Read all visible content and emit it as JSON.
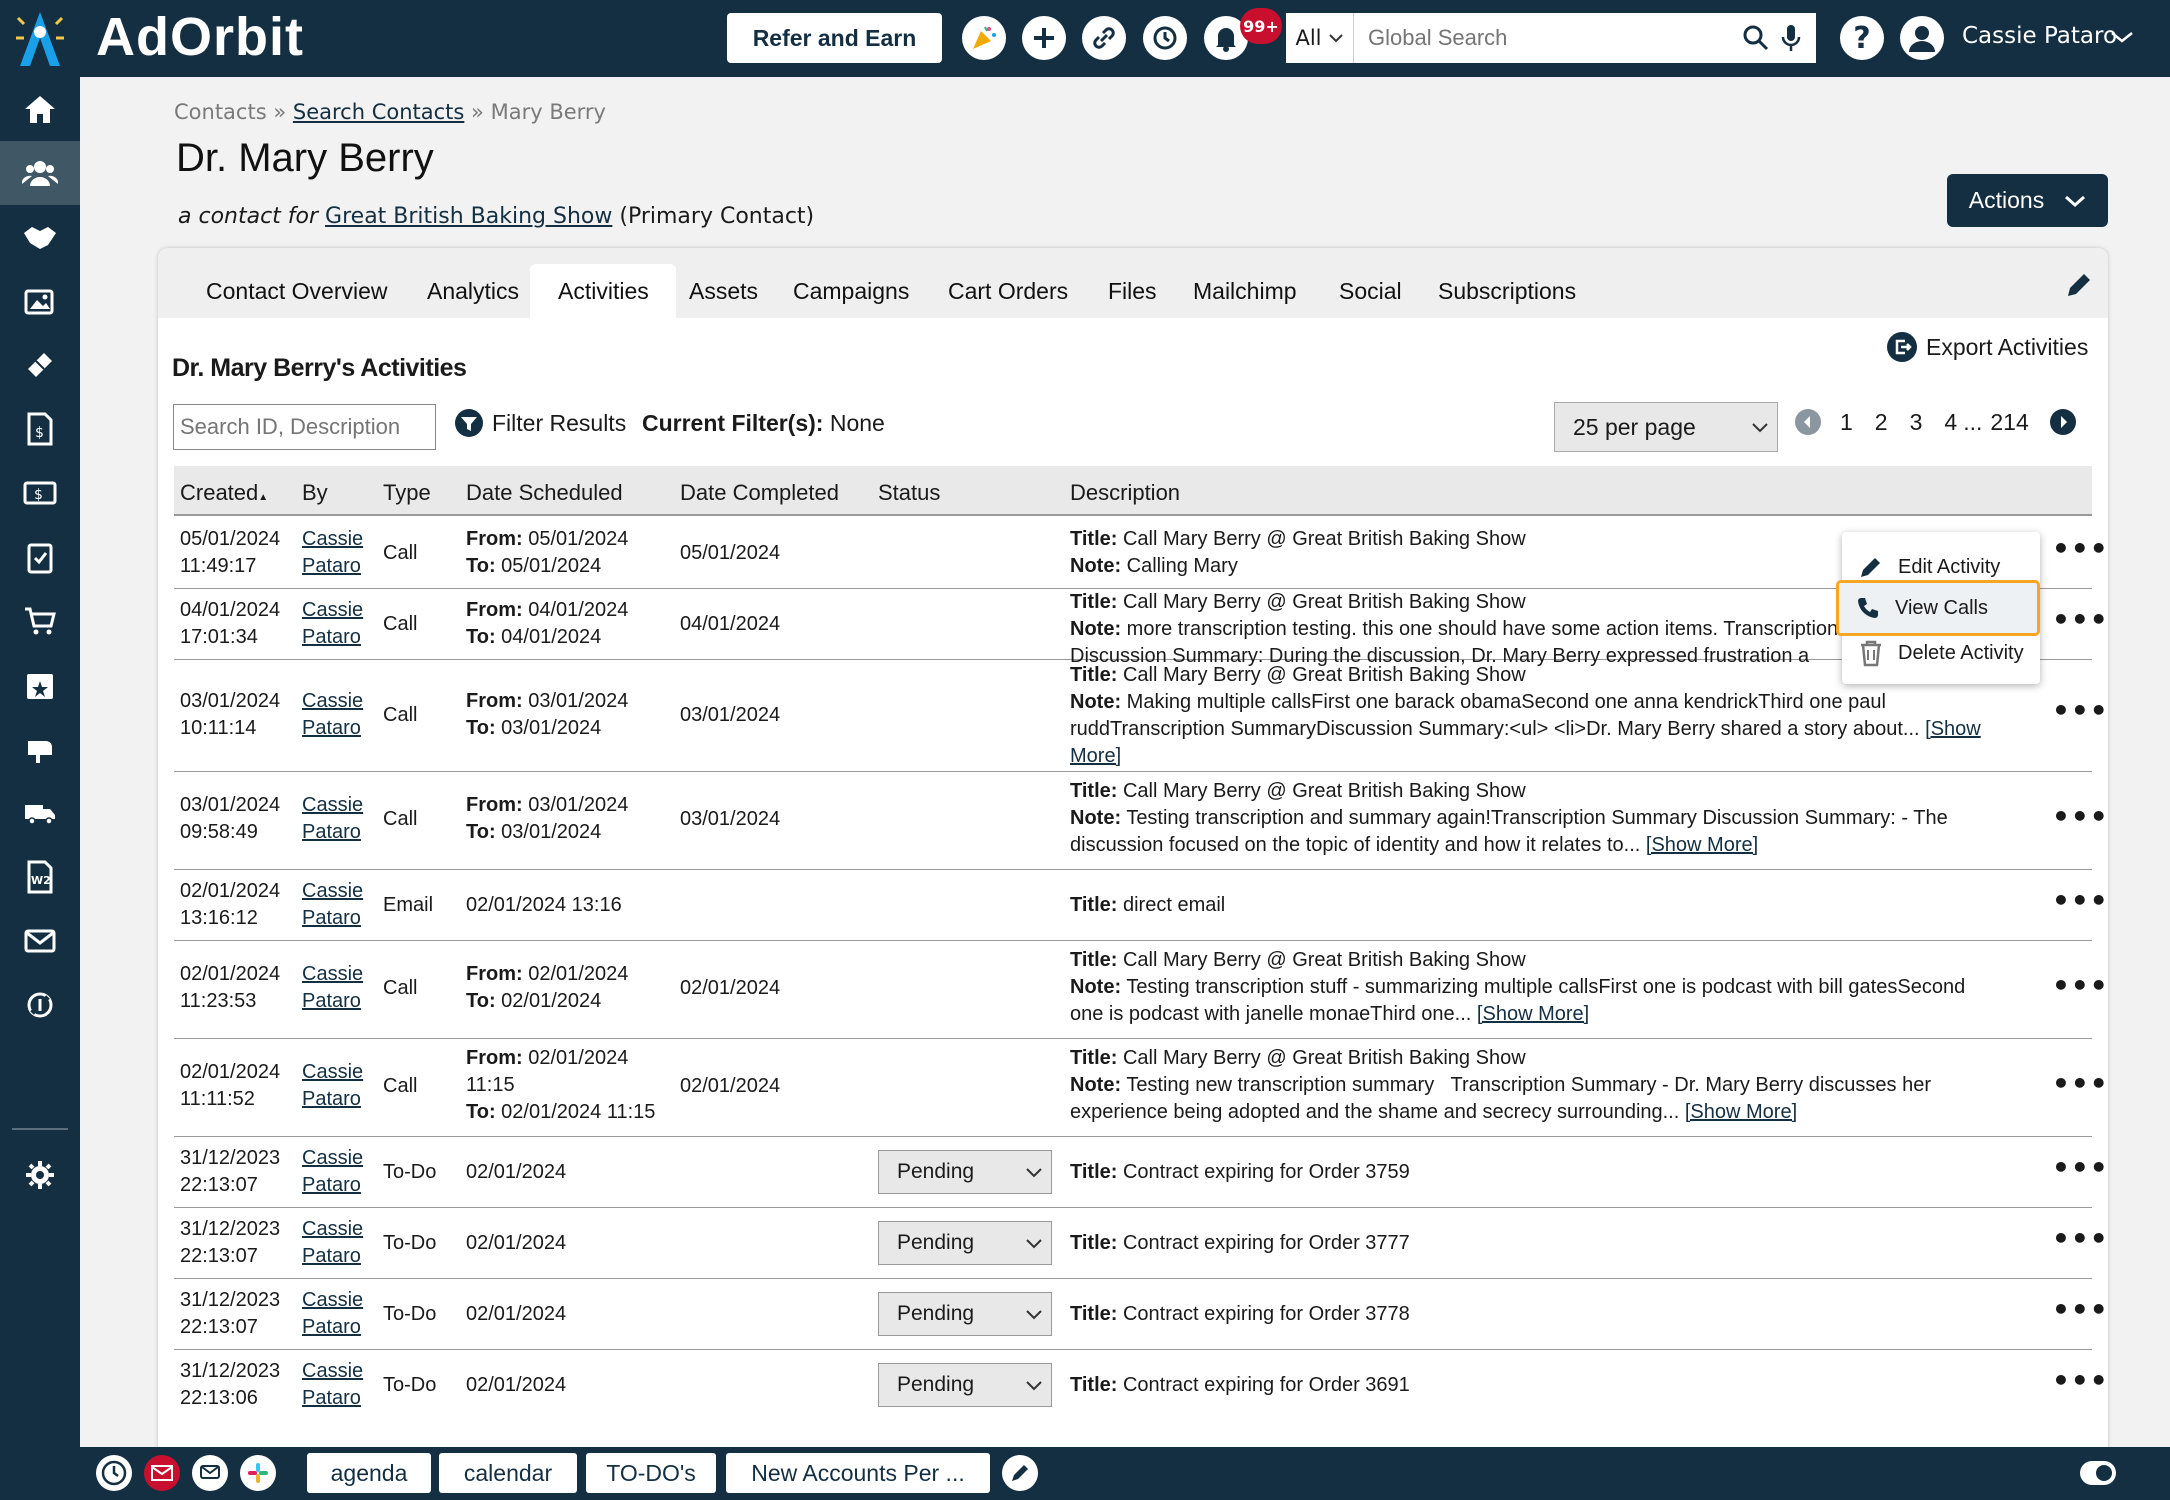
{
  "header": {
    "brand": "AdOrbit",
    "refer_label": "Refer and Earn",
    "notif_badge": "99+",
    "search_scope": "All",
    "search_placeholder": "Global Search",
    "user_name": "Cassie Pataro"
  },
  "breadcrumb": {
    "root": "Contacts",
    "sep": "»",
    "link": "Search Contacts",
    "current": "Mary Berry"
  },
  "page": {
    "title": "Dr. Mary Berry",
    "contact_for_prefix": "a contact for",
    "company": "Great British Baking Show",
    "contact_role": "(Primary Contact)",
    "actions_label": "Actions"
  },
  "tabs": [
    "Contact Overview",
    "Analytics",
    "Activities",
    "Assets",
    "Campaigns",
    "Cart Orders",
    "Files",
    "Mailchimp",
    "Social",
    "Subscriptions"
  ],
  "activities": {
    "title": "Dr. Mary Berry's Activities",
    "export_label": "Export Activities",
    "search_placeholder": "Search ID, Description",
    "filter_label": "Filter Results",
    "current_filter_label": "Current Filter(s):",
    "current_filter_value": "None",
    "per_page": "25 per page",
    "pages": [
      "1",
      "2",
      "3",
      "4",
      "...",
      "214"
    ]
  },
  "table": {
    "columns": [
      "Created",
      "By",
      "Type",
      "Date Scheduled",
      "Date Completed",
      "Status",
      "Description"
    ],
    "sort_indicator": "▲",
    "rows": [
      {
        "created_date": "05/01/2024",
        "created_time": "11:49:17",
        "by_first": "Cassie",
        "by_last": "Pataro",
        "type": "Call",
        "sched_from": "05/01/2024",
        "sched_to": "05/01/2024",
        "completed": "05/01/2024",
        "title": "Call Mary Berry @ Great British Baking Show",
        "note": "Calling Mary"
      },
      {
        "created_date": "04/01/2024",
        "created_time": "17:01:34",
        "by_first": "Cassie",
        "by_last": "Pataro",
        "type": "Call",
        "sched_from": "04/01/2024",
        "sched_to": "04/01/2024",
        "completed": "04/01/2024",
        "title": "Call Mary Berry @ Great British Baking Show",
        "note": "more transcription testing. this one should have some action items. Transcription",
        "note2": "Discussion Summary: During the discussion, Dr. Mary Berry expressed frustration a"
      },
      {
        "created_date": "03/01/2024",
        "created_time": "10:11:14",
        "by_first": "Cassie",
        "by_last": "Pataro",
        "type": "Call",
        "sched_from": "03/01/2024",
        "sched_to": "03/01/2024",
        "completed": "03/01/2024",
        "title": "Call Mary Berry @ Great British Baking Show",
        "note": "Making multiple callsFirst one barack obamaSecond one anna kendrickThird one paul",
        "note2": "ruddTranscription SummaryDiscussion Summary:<ul> <li>Dr. Mary Berry shared a story about...",
        "more": "[Show",
        "more2": "More]"
      },
      {
        "created_date": "03/01/2024",
        "created_time": "09:58:49",
        "by_first": "Cassie",
        "by_last": "Pataro",
        "type": "Call",
        "sched_from": "03/01/2024",
        "sched_to": "03/01/2024",
        "completed": "03/01/2024",
        "title": "Call Mary Berry @ Great British Baking Show",
        "note": "Testing transcription and summary again!Transcription Summary Discussion Summary: - The",
        "note2": "discussion focused on the topic of identity and how it relates to...",
        "more": "[Show More]"
      },
      {
        "created_date": "02/01/2024",
        "created_time": "13:16:12",
        "by_first": "Cassie",
        "by_last": "Pataro",
        "type": "Email",
        "scheduled": "02/01/2024 13:16",
        "title": "direct email"
      },
      {
        "created_date": "02/01/2024",
        "created_time": "11:23:53",
        "by_first": "Cassie",
        "by_last": "Pataro",
        "type": "Call",
        "sched_from": "02/01/2024",
        "sched_to": "02/01/2024",
        "completed": "02/01/2024",
        "title": "Call Mary Berry @ Great British Baking Show",
        "note": "Testing transcription stuff - summarizing multiple callsFirst one is podcast with bill gatesSecond",
        "note2": "one is podcast with janelle monaeThird one...",
        "more": "[Show More]"
      },
      {
        "created_date": "02/01/2024",
        "created_time": "11:11:52",
        "by_first": "Cassie",
        "by_last": "Pataro",
        "type": "Call",
        "sched_from": "02/01/2024",
        "sched_from2": "11:15",
        "sched_to": "02/01/2024 11:15",
        "completed": "02/01/2024",
        "title": "Call Mary Berry @ Great British Baking Show",
        "note": "Testing new transcription summary   Transcription Summary - Dr. Mary Berry discusses her",
        "note2": "experience being adopted and the shame and secrecy surrounding...",
        "more": "[Show More]"
      },
      {
        "created_date": "31/12/2023",
        "created_time": "22:13:07",
        "by_first": "Cassie",
        "by_last": "Pataro",
        "type": "To-Do",
        "scheduled": "02/01/2024",
        "status": "Pending",
        "title": "Contract expiring for Order 3759"
      },
      {
        "created_date": "31/12/2023",
        "created_time": "22:13:07",
        "by_first": "Cassie",
        "by_last": "Pataro",
        "type": "To-Do",
        "scheduled": "02/01/2024",
        "status": "Pending",
        "title": "Contract expiring for Order 3777"
      },
      {
        "created_date": "31/12/2023",
        "created_time": "22:13:07",
        "by_first": "Cassie",
        "by_last": "Pataro",
        "type": "To-Do",
        "scheduled": "02/01/2024",
        "status": "Pending",
        "title": "Contract expiring for Order 3778"
      },
      {
        "created_date": "31/12/2023",
        "created_time": "22:13:06",
        "by_first": "Cassie",
        "by_last": "Pataro",
        "type": "To-Do",
        "scheduled": "02/01/2024",
        "status": "Pending",
        "title": "Contract expiring for Order 3691"
      }
    ],
    "labels": {
      "from": "From:",
      "to": "To:",
      "title": "Title:",
      "note": "Note:"
    }
  },
  "context_menu": {
    "edit": "Edit Activity",
    "view_calls": "View Calls",
    "delete": "Delete Activity"
  },
  "bottom_bar": {
    "agenda": "agenda",
    "calendar": "calendar",
    "todos": "TO-DO's",
    "new_accounts": "New Accounts Per ..."
  },
  "colors": {
    "navy": "#142f42",
    "highlight": "#f5a623",
    "badge": "#c8102e"
  }
}
